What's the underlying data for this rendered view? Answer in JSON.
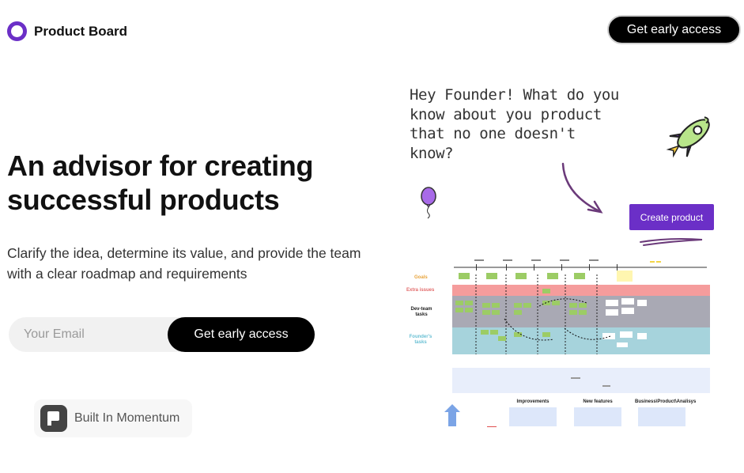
{
  "brand": {
    "name": "Product Board",
    "accent": "#6b2fc7"
  },
  "header": {
    "cta_label": "Get early access"
  },
  "hero": {
    "headline": "An advisor for creating successful products",
    "subtext": "Clarify the idea, determine its value, and provide the team with a clear roadmap and requirements"
  },
  "signup": {
    "email_placeholder": "Your Email",
    "email_value": "",
    "cta_label": "Get early access"
  },
  "badge": {
    "label": "Built In Momentum"
  },
  "illustration": {
    "handwritten_note": "Hey Founder! What do you know about you product that no one doesn't know?",
    "create_button_label": "Create product",
    "board": {
      "lane_labels": [
        "Goals",
        "Extra issues",
        "Dev-team tasks",
        "Founder's tasks"
      ],
      "bottom_labels": [
        "Improvements",
        "New features",
        "Business\\Product\\Analisys"
      ]
    }
  }
}
